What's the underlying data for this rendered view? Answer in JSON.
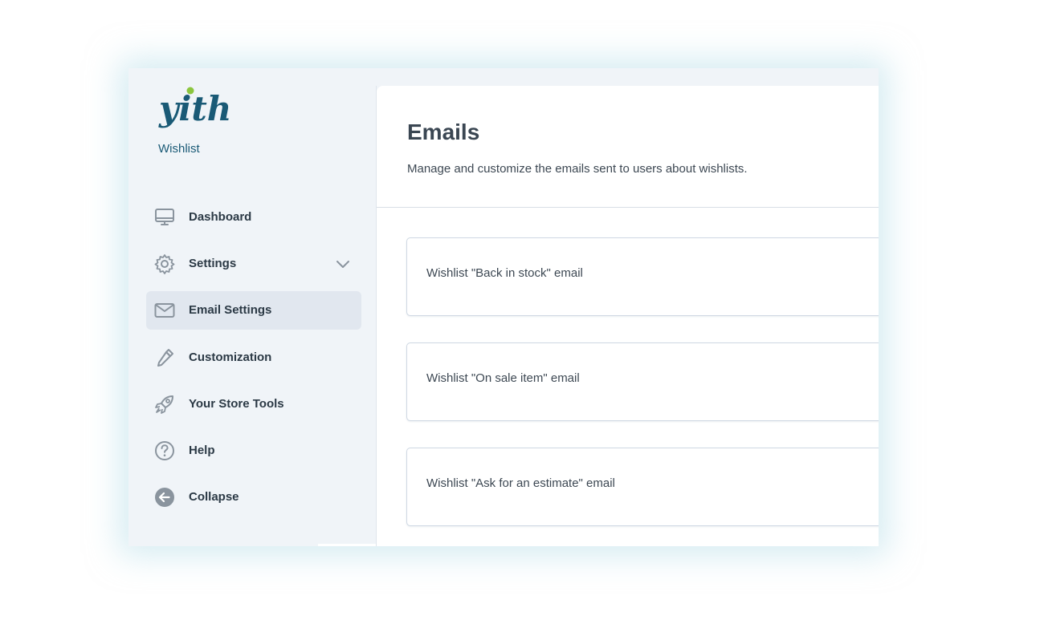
{
  "sidebar": {
    "logo_text": "yith",
    "product_name": "Wishlist",
    "items": [
      {
        "label": "Dashboard",
        "icon": "monitor-icon"
      },
      {
        "label": "Settings",
        "icon": "gear-icon"
      },
      {
        "label": "Email Settings",
        "icon": "envelope-icon"
      },
      {
        "label": "Customization",
        "icon": "dropper-icon"
      },
      {
        "label": "Your Store Tools",
        "icon": "rocket-icon"
      },
      {
        "label": "Help",
        "icon": "question-icon"
      },
      {
        "label": "Collapse",
        "icon": "arrow-left-circle-icon"
      }
    ]
  },
  "main": {
    "title": "Emails",
    "description": "Manage and customize the emails sent to users about wishlists.",
    "emails": [
      {
        "label": "Wishlist \"Back in stock\" email"
      },
      {
        "label": "Wishlist \"On sale item\" email"
      },
      {
        "label": "Wishlist \"Ask for an estimate\" email"
      }
    ]
  },
  "colors": {
    "brand_dark": "#1a5a76",
    "brand_accent": "#8cc63f",
    "nav_active_bg": "#e1e7ef",
    "icon_gray": "#8a949e"
  }
}
